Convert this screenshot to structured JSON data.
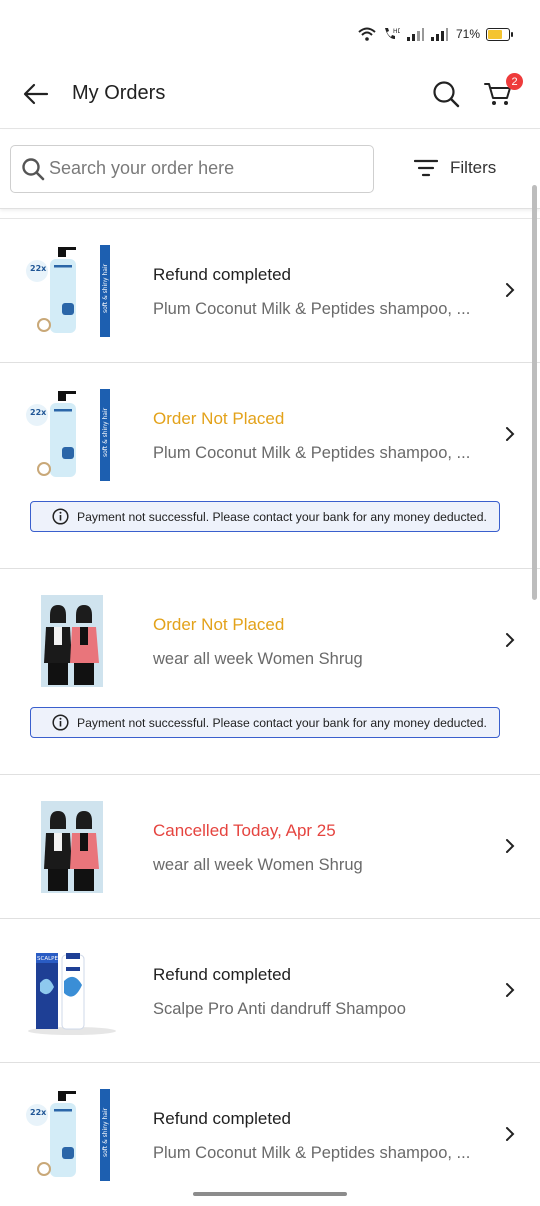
{
  "status_bar": {
    "battery_percent": "71%",
    "battery_level": 0.71
  },
  "header": {
    "title": "My Orders",
    "cart_count": "2"
  },
  "search": {
    "placeholder": "Search your order here",
    "value": ""
  },
  "filters": {
    "label": "Filters"
  },
  "colors": {
    "refund": "#212121",
    "not_placed": "#e3a21a",
    "cancelled": "#e5443f",
    "alert_border": "#3a5fcd",
    "badge": "#ee3b3b"
  },
  "orders": [
    {
      "status": "Refund completed",
      "product": "Plum Coconut Milk & Peptides shampoo, ...",
      "image": "shampoo-bottle"
    },
    {
      "status": "Order Not Placed",
      "product": "Plum Coconut Milk & Peptides shampoo, ...",
      "image": "shampoo-bottle",
      "alert": "Payment not successful. Please contact your bank for any money deducted."
    },
    {
      "status": "Order Not Placed",
      "product": "wear all week Women Shrug",
      "image": "women-shrug",
      "alert": "Payment not successful. Please contact your bank for any money deducted."
    },
    {
      "status": "Cancelled Today, Apr 25",
      "product": "wear all week Women Shrug",
      "image": "women-shrug"
    },
    {
      "status": "Refund completed",
      "product": "Scalpe Pro Anti dandruff Shampoo",
      "image": "scalpe-shampoo"
    },
    {
      "status": "Refund completed",
      "product": "Plum Coconut Milk & Peptides shampoo, ...",
      "image": "shampoo-bottle"
    }
  ]
}
